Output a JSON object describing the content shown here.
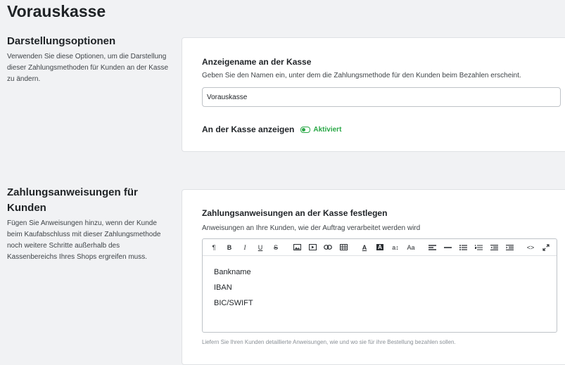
{
  "page": {
    "title": "Vorauskasse"
  },
  "display_options": {
    "title": "Darstellungsoptionen",
    "description": "Verwenden Sie diese Optionen, um die Darstellung dieser Zahlungsmethoden für Kunden an der Kasse zu ändern.",
    "card": {
      "heading": "Anzeigename an der Kasse",
      "help": "Geben Sie den Namen ein, unter dem die Zahlungsmethode für den Kunden beim Bezahlen erscheint.",
      "input_value": "Vorauskasse",
      "checkout_label": "An der Kasse anzeigen",
      "toggle_label": "Aktiviert",
      "toggle_color": "#28a745"
    }
  },
  "instructions": {
    "title_line1": "Zahlungsanweisungen für",
    "title_line2": "Kunden",
    "description": "Fügen Sie Anweisungen hinzu, wenn der Kunde beim Kaufabschluss mit dieser Zahlungsmethode noch weitere Schritte außerhalb des Kassenbereichs Ihres Shops ergreifen muss.",
    "card": {
      "heading": "Zahlungsanweisungen an der Kasse festlegen",
      "help": "Anweisungen an Ihre Kunden, wie der Auftrag verarbeitet werden wird",
      "editor_lines": [
        "Bankname",
        "IBAN",
        "BIC/SWIFT"
      ],
      "footnote": "Liefern Sie Ihren Kunden detaillierte Anweisungen, wie und wo sie für ihre Bestellung bezahlen sollen."
    }
  },
  "toolbar": {
    "paragraph": "¶",
    "bold": "B",
    "italic": "I",
    "underline": "U",
    "strike": "S",
    "font_color": "A",
    "bg_color": "A",
    "font_size": "a↕",
    "text_case": "Aa",
    "code": "<>"
  }
}
